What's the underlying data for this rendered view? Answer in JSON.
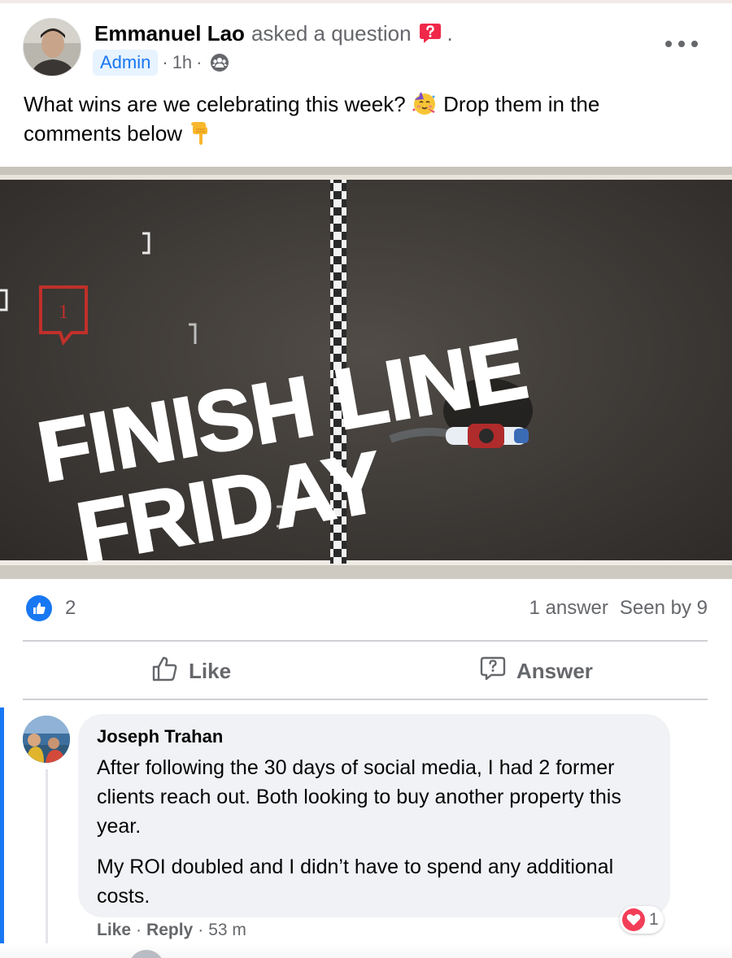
{
  "post": {
    "author": "Emmanuel Lao",
    "action_text": "asked a question",
    "trailing_dot": ".",
    "badge": "Admin",
    "time": "1h",
    "meta_sep": "·",
    "text_before_emoji": "What wins are we celebrating this week? ",
    "text_middle": " Drop them in the comments below ",
    "image": {
      "headline_line1": "FINISH LINE",
      "headline_line2": "FRIDAY",
      "badge_number": "1"
    },
    "reaction_count": "2",
    "answers_text": "1 answer",
    "seen_text": "Seen by 9",
    "like_label": "Like",
    "answer_label": "Answer"
  },
  "comment": {
    "author": "Joseph Trahan",
    "paragraph1": "After following the 30 days of social media, I had 2 former clients reach out. Both looking to buy another property this year.",
    "paragraph2": "My ROI doubled and I didn’t have to spend any additional costs.",
    "like_action": "Like",
    "reply_action": "Reply",
    "sep": "·",
    "time": "53 m",
    "reaction_count": "1"
  },
  "colors": {
    "accent": "#1877f2",
    "secondary_text": "#65676b",
    "bubble_bg": "#f0f2f5",
    "heart": "#f33e58",
    "question_icon": "#f02849"
  },
  "icons": [
    "question-icon",
    "members-icon",
    "more-icon",
    "partying-face-emoji",
    "pointing-down-emoji",
    "thumbs-up-icon",
    "answer-icon",
    "heart-icon"
  ]
}
